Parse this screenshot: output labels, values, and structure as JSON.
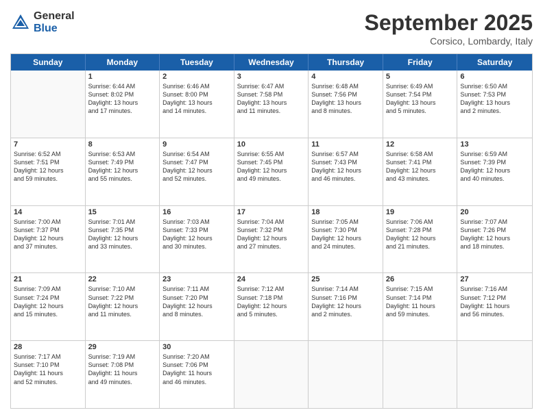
{
  "logo": {
    "general": "General",
    "blue": "Blue"
  },
  "title": "September 2025",
  "subtitle": "Corsico, Lombardy, Italy",
  "header_days": [
    "Sunday",
    "Monday",
    "Tuesday",
    "Wednesday",
    "Thursday",
    "Friday",
    "Saturday"
  ],
  "weeks": [
    [
      {
        "day": "",
        "text": ""
      },
      {
        "day": "1",
        "text": "Sunrise: 6:44 AM\nSunset: 8:02 PM\nDaylight: 13 hours\nand 17 minutes."
      },
      {
        "day": "2",
        "text": "Sunrise: 6:46 AM\nSunset: 8:00 PM\nDaylight: 13 hours\nand 14 minutes."
      },
      {
        "day": "3",
        "text": "Sunrise: 6:47 AM\nSunset: 7:58 PM\nDaylight: 13 hours\nand 11 minutes."
      },
      {
        "day": "4",
        "text": "Sunrise: 6:48 AM\nSunset: 7:56 PM\nDaylight: 13 hours\nand 8 minutes."
      },
      {
        "day": "5",
        "text": "Sunrise: 6:49 AM\nSunset: 7:54 PM\nDaylight: 13 hours\nand 5 minutes."
      },
      {
        "day": "6",
        "text": "Sunrise: 6:50 AM\nSunset: 7:53 PM\nDaylight: 13 hours\nand 2 minutes."
      }
    ],
    [
      {
        "day": "7",
        "text": "Sunrise: 6:52 AM\nSunset: 7:51 PM\nDaylight: 12 hours\nand 59 minutes."
      },
      {
        "day": "8",
        "text": "Sunrise: 6:53 AM\nSunset: 7:49 PM\nDaylight: 12 hours\nand 55 minutes."
      },
      {
        "day": "9",
        "text": "Sunrise: 6:54 AM\nSunset: 7:47 PM\nDaylight: 12 hours\nand 52 minutes."
      },
      {
        "day": "10",
        "text": "Sunrise: 6:55 AM\nSunset: 7:45 PM\nDaylight: 12 hours\nand 49 minutes."
      },
      {
        "day": "11",
        "text": "Sunrise: 6:57 AM\nSunset: 7:43 PM\nDaylight: 12 hours\nand 46 minutes."
      },
      {
        "day": "12",
        "text": "Sunrise: 6:58 AM\nSunset: 7:41 PM\nDaylight: 12 hours\nand 43 minutes."
      },
      {
        "day": "13",
        "text": "Sunrise: 6:59 AM\nSunset: 7:39 PM\nDaylight: 12 hours\nand 40 minutes."
      }
    ],
    [
      {
        "day": "14",
        "text": "Sunrise: 7:00 AM\nSunset: 7:37 PM\nDaylight: 12 hours\nand 37 minutes."
      },
      {
        "day": "15",
        "text": "Sunrise: 7:01 AM\nSunset: 7:35 PM\nDaylight: 12 hours\nand 33 minutes."
      },
      {
        "day": "16",
        "text": "Sunrise: 7:03 AM\nSunset: 7:33 PM\nDaylight: 12 hours\nand 30 minutes."
      },
      {
        "day": "17",
        "text": "Sunrise: 7:04 AM\nSunset: 7:32 PM\nDaylight: 12 hours\nand 27 minutes."
      },
      {
        "day": "18",
        "text": "Sunrise: 7:05 AM\nSunset: 7:30 PM\nDaylight: 12 hours\nand 24 minutes."
      },
      {
        "day": "19",
        "text": "Sunrise: 7:06 AM\nSunset: 7:28 PM\nDaylight: 12 hours\nand 21 minutes."
      },
      {
        "day": "20",
        "text": "Sunrise: 7:07 AM\nSunset: 7:26 PM\nDaylight: 12 hours\nand 18 minutes."
      }
    ],
    [
      {
        "day": "21",
        "text": "Sunrise: 7:09 AM\nSunset: 7:24 PM\nDaylight: 12 hours\nand 15 minutes."
      },
      {
        "day": "22",
        "text": "Sunrise: 7:10 AM\nSunset: 7:22 PM\nDaylight: 12 hours\nand 11 minutes."
      },
      {
        "day": "23",
        "text": "Sunrise: 7:11 AM\nSunset: 7:20 PM\nDaylight: 12 hours\nand 8 minutes."
      },
      {
        "day": "24",
        "text": "Sunrise: 7:12 AM\nSunset: 7:18 PM\nDaylight: 12 hours\nand 5 minutes."
      },
      {
        "day": "25",
        "text": "Sunrise: 7:14 AM\nSunset: 7:16 PM\nDaylight: 12 hours\nand 2 minutes."
      },
      {
        "day": "26",
        "text": "Sunrise: 7:15 AM\nSunset: 7:14 PM\nDaylight: 11 hours\nand 59 minutes."
      },
      {
        "day": "27",
        "text": "Sunrise: 7:16 AM\nSunset: 7:12 PM\nDaylight: 11 hours\nand 56 minutes."
      }
    ],
    [
      {
        "day": "28",
        "text": "Sunrise: 7:17 AM\nSunset: 7:10 PM\nDaylight: 11 hours\nand 52 minutes."
      },
      {
        "day": "29",
        "text": "Sunrise: 7:19 AM\nSunset: 7:08 PM\nDaylight: 11 hours\nand 49 minutes."
      },
      {
        "day": "30",
        "text": "Sunrise: 7:20 AM\nSunset: 7:06 PM\nDaylight: 11 hours\nand 46 minutes."
      },
      {
        "day": "",
        "text": ""
      },
      {
        "day": "",
        "text": ""
      },
      {
        "day": "",
        "text": ""
      },
      {
        "day": "",
        "text": ""
      }
    ]
  ]
}
